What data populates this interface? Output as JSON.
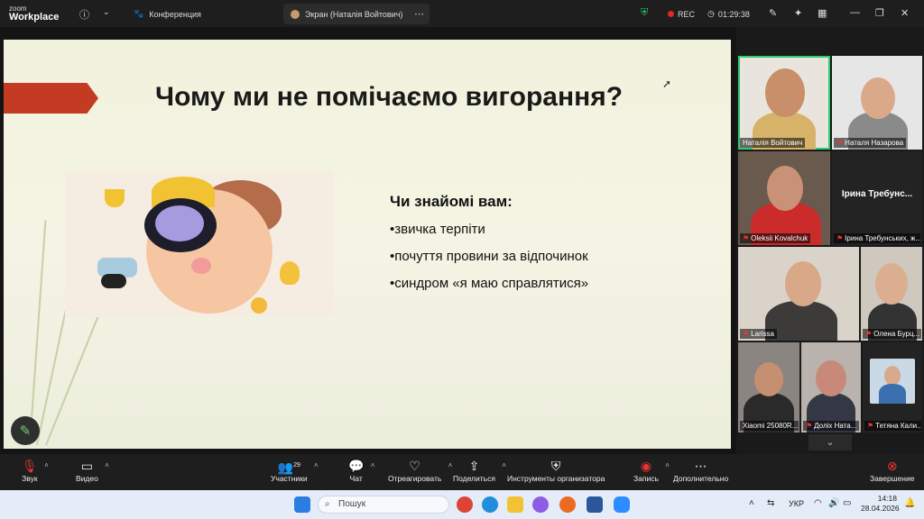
{
  "app": {
    "logo_top": "zoom",
    "logo_bottom": "Workplace"
  },
  "tabs": [
    {
      "label": "Конференция"
    },
    {
      "label": "Экран (Наталія Войтович)"
    }
  ],
  "status": {
    "rec": "REC",
    "timer": "01:29:38"
  },
  "slide": {
    "title": "Чому ми не помічаємо вигорання?",
    "bullets_heading": "Чи знайомі вам:",
    "bullets": [
      "•звичка терпіти",
      "•почуття провини за відпочинок",
      "•синдром «я маю справлятися»"
    ]
  },
  "participants": [
    {
      "name": "Наталія Войтович",
      "muted": false
    },
    {
      "name": "Наталя Назарова",
      "muted": true
    },
    {
      "name": "Oleksii Kovalchuk",
      "muted": true
    },
    {
      "name": "Ірина Требунських, ж...",
      "muted": true,
      "placeholder": "Ірина Требунс..."
    },
    {
      "name": "Larissa",
      "muted": true
    },
    {
      "name": "Олена Бурц...",
      "muted": true
    },
    {
      "name": "Xiaomi 25080R...",
      "muted": false
    },
    {
      "name": "Доліх Ната...",
      "muted": true
    },
    {
      "name": "Тетяна Кали...",
      "muted": true
    }
  ],
  "toolbar": {
    "audio": "Звук",
    "video": "Видео",
    "participants": "Участники",
    "participants_count": "29",
    "chat": "Чат",
    "react": "Отреагировать",
    "share": "Поделиться",
    "host_tools": "Инструменты организатора",
    "record": "Запись",
    "more": "Дополнительно",
    "end": "Завершение"
  },
  "taskbar": {
    "search_placeholder": "Пошук",
    "lang": "УКР",
    "time": "14:18",
    "date": "28.04.2026"
  },
  "colors": {
    "accent_red": "#c23b22",
    "speaker_green": "#2ecc71",
    "rec_red": "#e02828"
  }
}
